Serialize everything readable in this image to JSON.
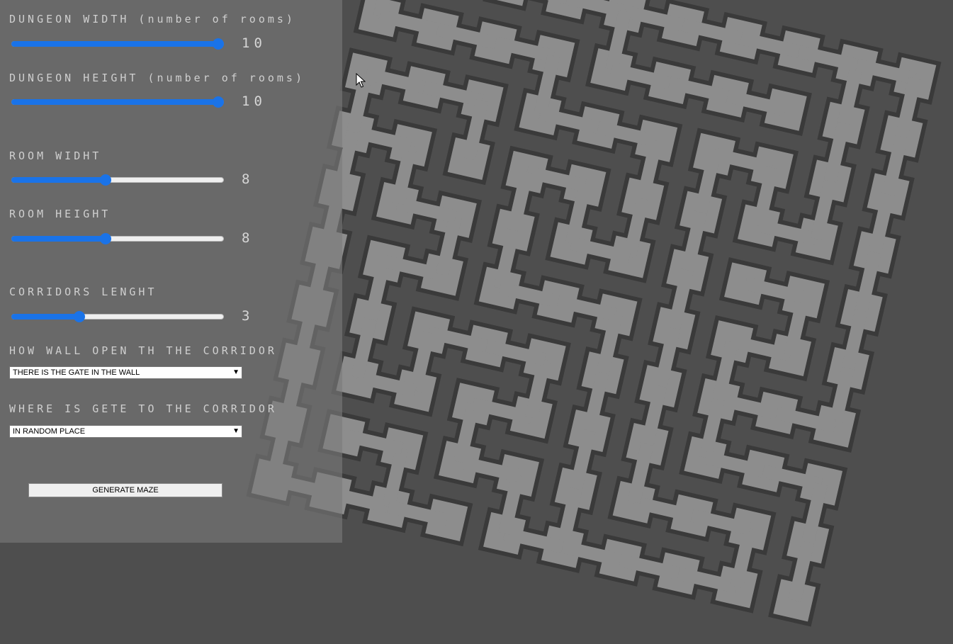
{
  "controls": {
    "dungeon_width": {
      "label": "DUNGEON WIDTH (number of rooms)",
      "value": "10",
      "fraction": 1.0
    },
    "dungeon_height": {
      "label": "DUNGEON HEIGHT (number of rooms)",
      "value": "10",
      "fraction": 1.0
    },
    "room_width": {
      "label": "ROOM WIDHT",
      "value": "8",
      "fraction": 0.44
    },
    "room_height": {
      "label": "ROOM HEIGHT",
      "value": "8",
      "fraction": 0.44
    },
    "corridors_length": {
      "label": "CORRIDORS LENGHT",
      "value": "3",
      "fraction": 0.31
    },
    "wall_opening": {
      "label": "HOW WALL OPEN TH THE CORRIDOR",
      "selected": "THERE IS THE GATE IN THE WALL"
    },
    "gate_position": {
      "label": "WHERE IS GETE TO THE CORRIDOR",
      "selected": "IN RANDOM PLACE"
    },
    "generate_label": "GENERATE MAZE"
  },
  "maze": {
    "cols": 10,
    "rows": 10
  },
  "colors": {
    "background": "#4e4e4e",
    "floor": "#8d8d8d",
    "wall": "#3a3a3a",
    "slider_accent": "#1a73e8"
  },
  "icons": {
    "cursor": "mouse-pointer-icon",
    "dropdown": "chevron-down-icon"
  }
}
